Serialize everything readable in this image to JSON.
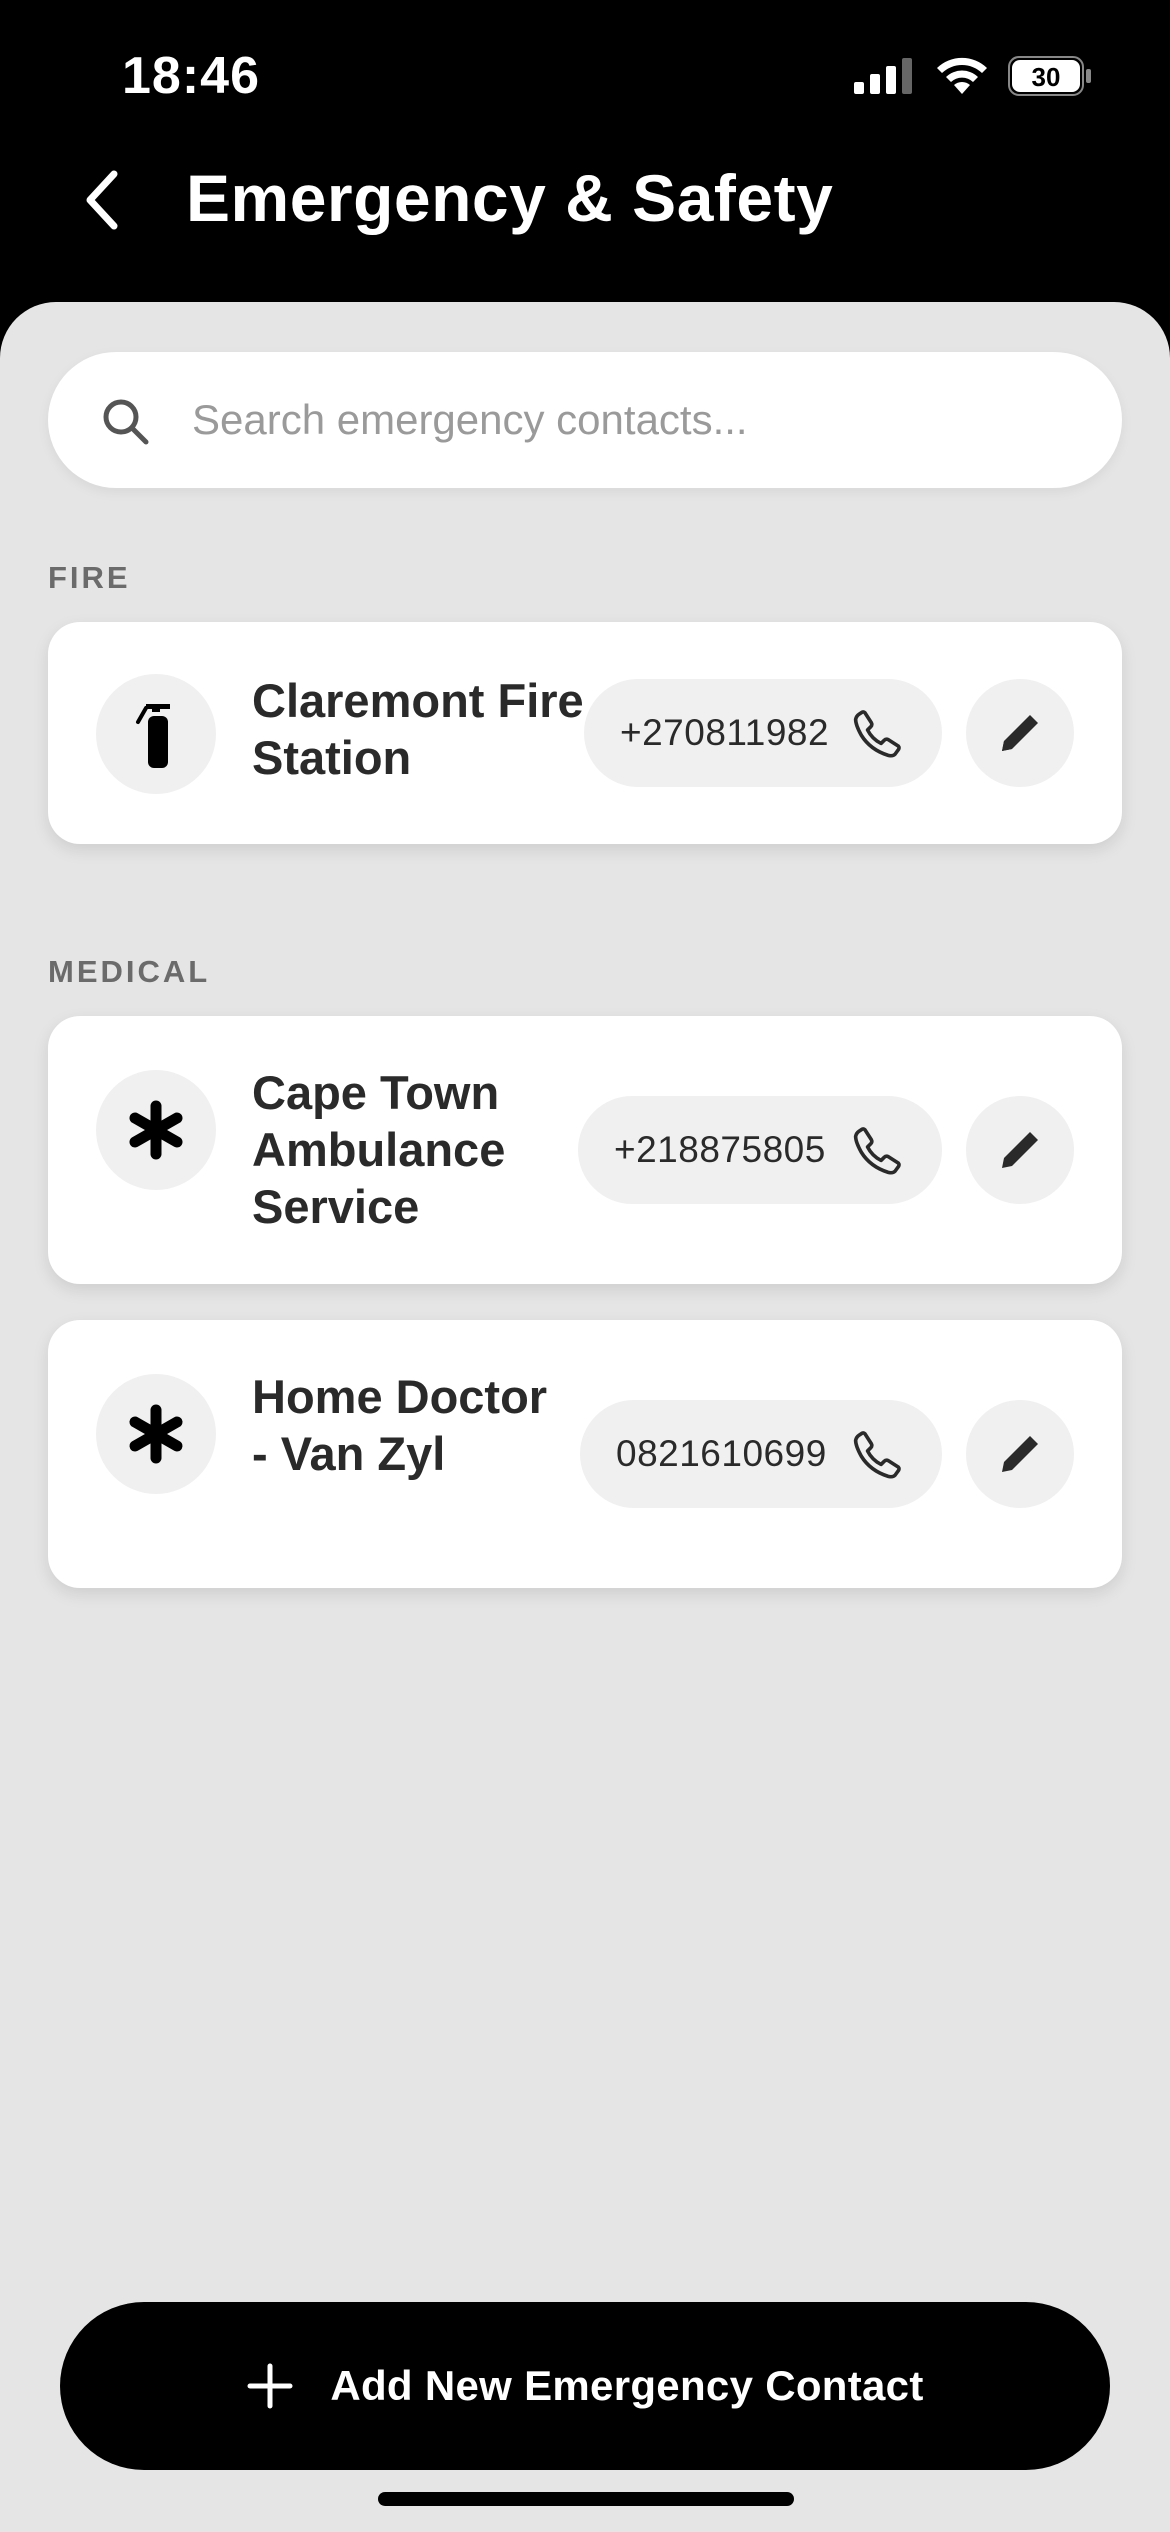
{
  "status_bar": {
    "time": "18:46",
    "battery": "30"
  },
  "header": {
    "title": "Emergency & Safety"
  },
  "search": {
    "placeholder": "Search emergency contacts..."
  },
  "sections": [
    {
      "label": "FIRE",
      "contacts": [
        {
          "name": "Claremont Fire Station",
          "phone": "+270811982",
          "icon": "fire-extinguisher-icon"
        }
      ]
    },
    {
      "label": "MEDICAL",
      "contacts": [
        {
          "name": "Cape Town Ambulance Service",
          "phone": "+218875805",
          "icon": "medical-asterisk-icon"
        },
        {
          "name": "Home Doctor - Van Zyl",
          "phone": "0821610699",
          "icon": "medical-asterisk-icon"
        }
      ]
    }
  ],
  "footer": {
    "add_label": "Add New Emergency Contact"
  },
  "colors": {
    "background": "#e5e5e5",
    "header": "#000000",
    "card": "#ffffff",
    "pill": "#f0f0f0",
    "text": "#2a2a2a"
  }
}
